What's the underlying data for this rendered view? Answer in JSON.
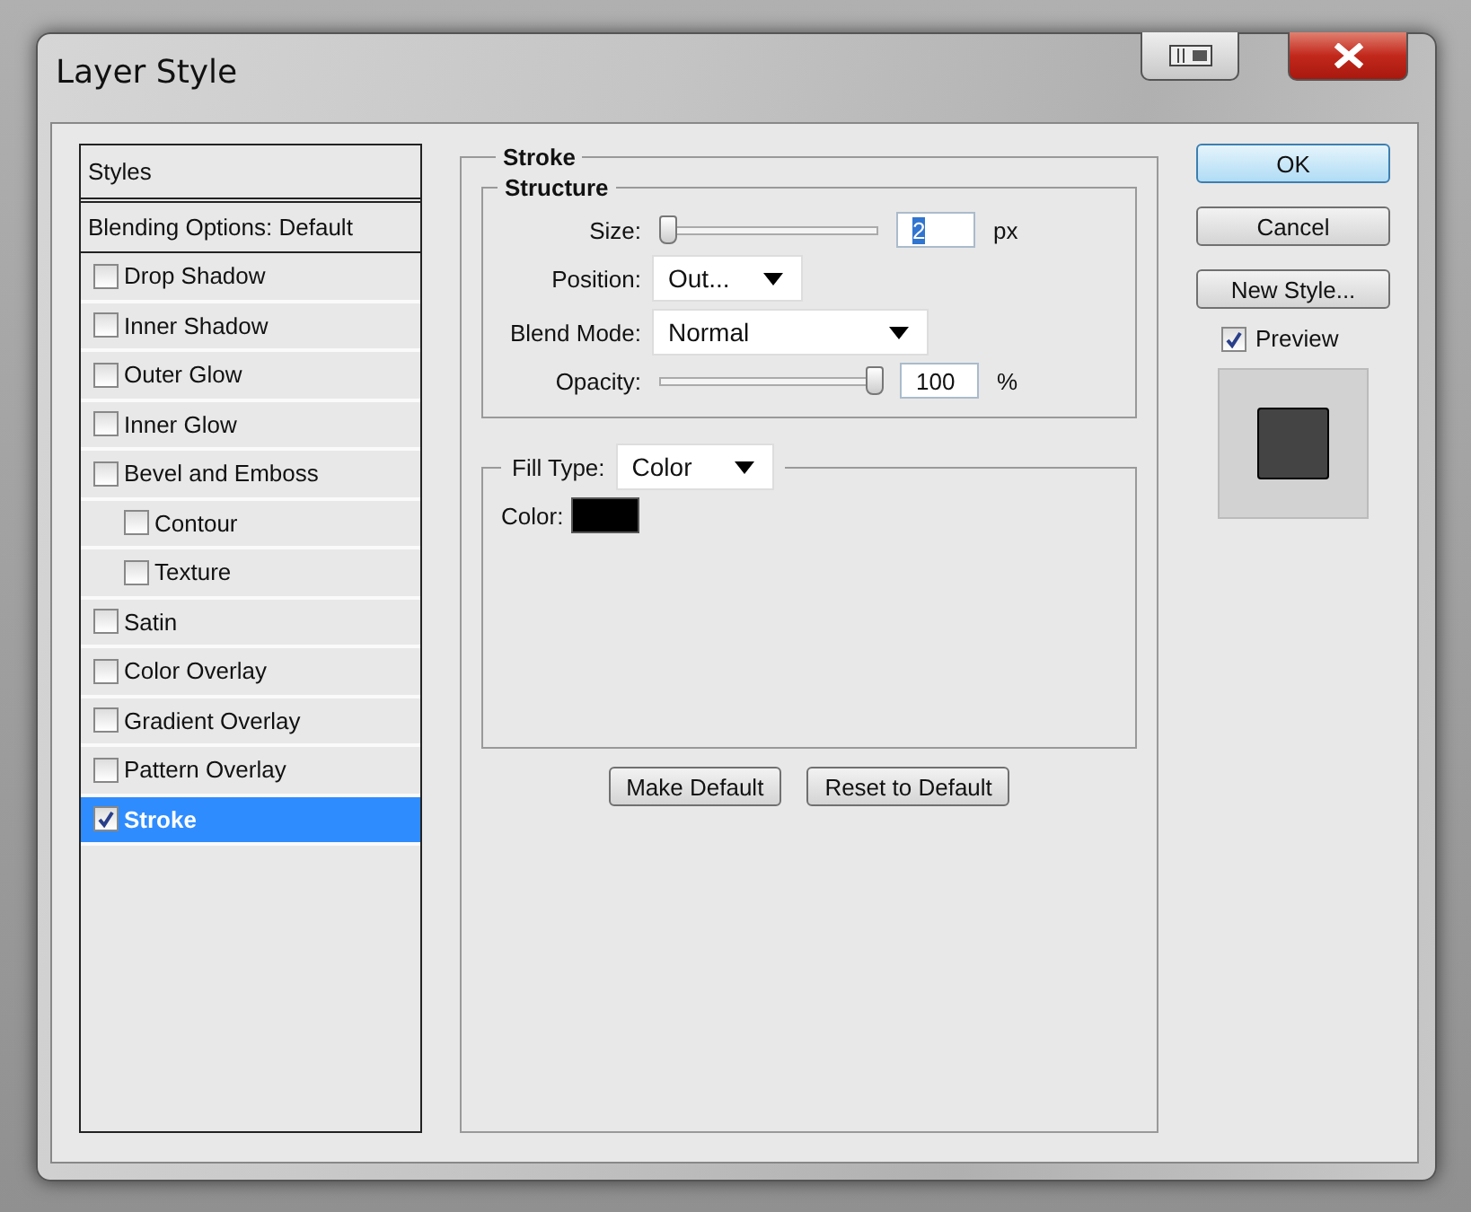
{
  "window": {
    "title": "Layer Style"
  },
  "styles_panel": {
    "header": "Styles",
    "blending": "Blending Options: Default",
    "items": [
      {
        "label": "Drop Shadow",
        "checked": false,
        "selected": false
      },
      {
        "label": "Inner Shadow",
        "checked": false,
        "selected": false
      },
      {
        "label": "Outer Glow",
        "checked": false,
        "selected": false
      },
      {
        "label": "Inner Glow",
        "checked": false,
        "selected": false
      },
      {
        "label": "Bevel and Emboss",
        "checked": false,
        "selected": false,
        "children": [
          {
            "label": "Contour",
            "checked": false,
            "selected": false
          },
          {
            "label": "Texture",
            "checked": false,
            "selected": false
          }
        ]
      },
      {
        "label": "Satin",
        "checked": false,
        "selected": false
      },
      {
        "label": "Color Overlay",
        "checked": false,
        "selected": false
      },
      {
        "label": "Gradient Overlay",
        "checked": false,
        "selected": false
      },
      {
        "label": "Pattern Overlay",
        "checked": false,
        "selected": false
      },
      {
        "label": "Stroke",
        "checked": true,
        "selected": true
      }
    ]
  },
  "stroke": {
    "title": "Stroke",
    "structure": {
      "title": "Structure",
      "size": {
        "label": "Size:",
        "level": 0.0,
        "value": "2",
        "value_selected": true,
        "unit": "px"
      },
      "position": {
        "label": "Position:",
        "value": "Out..."
      },
      "blend_mode": {
        "label": "Blend Mode:",
        "value": "Normal"
      },
      "opacity": {
        "label": "Opacity:",
        "level": 1.0,
        "value": "100",
        "value_selected": false,
        "unit": "%"
      }
    },
    "fill": {
      "label": "Fill Type:",
      "value": "Color",
      "color_label": "Color:",
      "color": "#000000"
    },
    "buttons": [
      "Make Default",
      "Reset to Default"
    ]
  },
  "actions": [
    {
      "label": "OK",
      "default": true
    },
    {
      "label": "Cancel",
      "default": false
    },
    {
      "label": "New Style...",
      "default": false
    }
  ],
  "preview": {
    "label": "Preview",
    "checked": true
  }
}
